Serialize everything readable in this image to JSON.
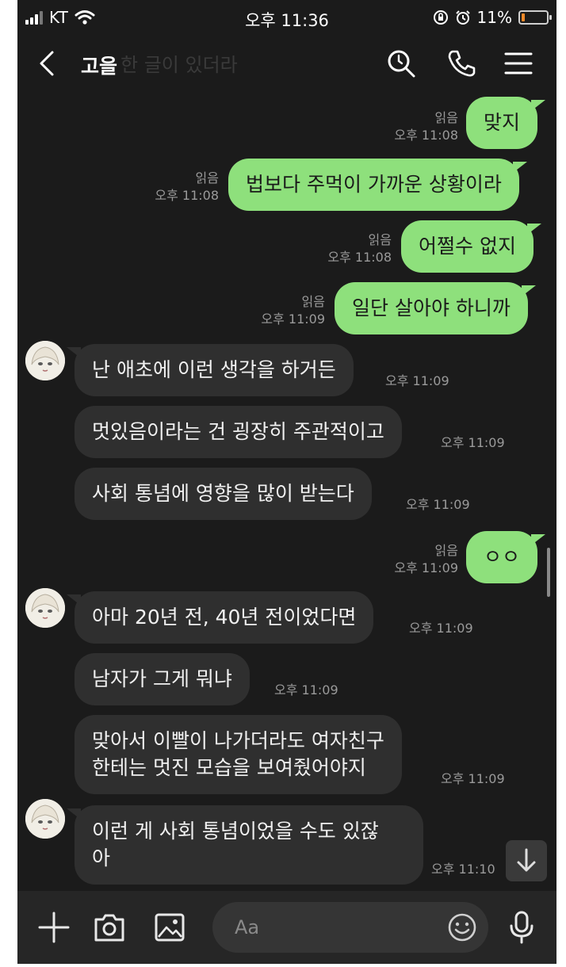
{
  "status_bar": {
    "carrier": "KT",
    "time": "오후 11:36",
    "battery": "11%",
    "battery_level": 0.11,
    "icons": [
      "signal-icon",
      "wifi-icon",
      "orientation-lock-icon",
      "alarm-icon",
      "battery-icon"
    ]
  },
  "header": {
    "title": "고을",
    "ghost_text": "한 글이 있더라",
    "icons": [
      "back-icon",
      "search-icon",
      "phone-icon",
      "menu-icon"
    ]
  },
  "messages": [
    {
      "dir": "out",
      "text": "맞지",
      "read": "읽음",
      "time": "오후 11:08"
    },
    {
      "dir": "out",
      "text": "법보다 주먹이 가까운 상황이라",
      "read": "읽음",
      "time": "오후 11:08"
    },
    {
      "dir": "out",
      "text": "어쩔수 없지",
      "read": "읽음",
      "time": "오후 11:08"
    },
    {
      "dir": "out",
      "text": "일단 살아야 하니까",
      "read": "읽음",
      "time": "오후 11:09"
    },
    {
      "dir": "in",
      "text": "난 애초에 이런 생각을 하거든",
      "time": "오후 11:09"
    },
    {
      "dir": "in",
      "text": "멋있음이라는 건 굉장히 주관적이고",
      "time": "오후 11:09"
    },
    {
      "dir": "in",
      "text": "사회 통념에 영향을 많이 받는다",
      "time": "오후 11:09"
    },
    {
      "dir": "out",
      "text": "ㅇㅇ",
      "read": "읽음",
      "time": "오후 11:09"
    },
    {
      "dir": "in",
      "text": "아마 20년 전, 40년 전이었다면",
      "time": "오후 11:09"
    },
    {
      "dir": "in",
      "text": "남자가 그게 뭐냐",
      "time": "오후 11:09"
    },
    {
      "dir": "in",
      "text": "맞아서 이빨이 나가더라도 여자친구",
      "text2": "한테는 멋진 모습을 보여줬어야지",
      "time": "오후 11:09"
    },
    {
      "dir": "in",
      "text": "이런 게 사회 통념이었을 수도 있잖",
      "text2": "아",
      "time": "오후 11:10"
    }
  ],
  "input_bar": {
    "placeholder": "Aa",
    "icons": [
      "plus-icon",
      "camera-icon",
      "image-icon",
      "emoji-icon",
      "microphone-icon"
    ]
  },
  "colors": {
    "background": "#1b1b1b",
    "outgoing_bubble": "#8ee07c",
    "incoming_bubble": "#2f2f2f",
    "meta_text": "#9a9a9a"
  }
}
